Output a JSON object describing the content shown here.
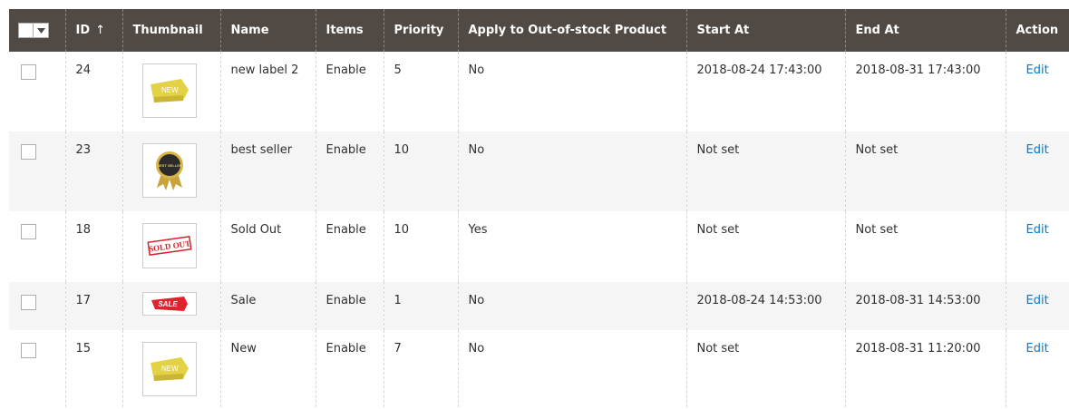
{
  "columns": {
    "id": "ID",
    "thumbnail": "Thumbnail",
    "name": "Name",
    "items": "Items",
    "priority": "Priority",
    "apply_oos": "Apply to Out-of-stock Product",
    "start_at": "Start At",
    "end_at": "End At",
    "action": "Action"
  },
  "sort": {
    "column": "ID",
    "direction": "ascending",
    "icon": "sort-ascending-arrow-icon"
  },
  "rows": [
    {
      "id": "24",
      "thumbnail_icon": "new-tag-label-icon",
      "name": "new label 2",
      "items": "Enable",
      "priority": "5",
      "apply_oos": "No",
      "start_at": "2018-08-24 17:43:00",
      "end_at": "2018-08-31 17:43:00",
      "action": "Edit"
    },
    {
      "id": "23",
      "thumbnail_icon": "best-seller-badge-icon",
      "name": "best seller",
      "items": "Enable",
      "priority": "10",
      "apply_oos": "No",
      "start_at": "Not set",
      "end_at": "Not set",
      "action": "Edit"
    },
    {
      "id": "18",
      "thumbnail_icon": "sold-out-stamp-icon",
      "name": "Sold Out",
      "items": "Enable",
      "priority": "10",
      "apply_oos": "Yes",
      "start_at": "Not set",
      "end_at": "Not set",
      "action": "Edit"
    },
    {
      "id": "17",
      "thumbnail_icon": "sale-ribbon-icon",
      "name": "Sale",
      "items": "Enable",
      "priority": "1",
      "apply_oos": "No",
      "start_at": "2018-08-24 14:53:00",
      "end_at": "2018-08-31 14:53:00",
      "action": "Edit"
    },
    {
      "id": "15",
      "thumbnail_icon": "new-tag-label-icon",
      "name": "New",
      "items": "Enable",
      "priority": "7",
      "apply_oos": "No",
      "start_at": "Not set",
      "end_at": "2018-08-31 11:20:00",
      "action": "Edit"
    }
  ],
  "thumbnail_art": {
    "new_tag": "NEW",
    "best_seller": "BEST SELLER",
    "sold_out": "SOLD OUT",
    "sale": "SALE"
  },
  "colors": {
    "header_bg": "#514943",
    "header_text": "#ffffff",
    "row_alt_bg": "#f5f5f5",
    "link": "#007bdb",
    "text": "#303030"
  }
}
